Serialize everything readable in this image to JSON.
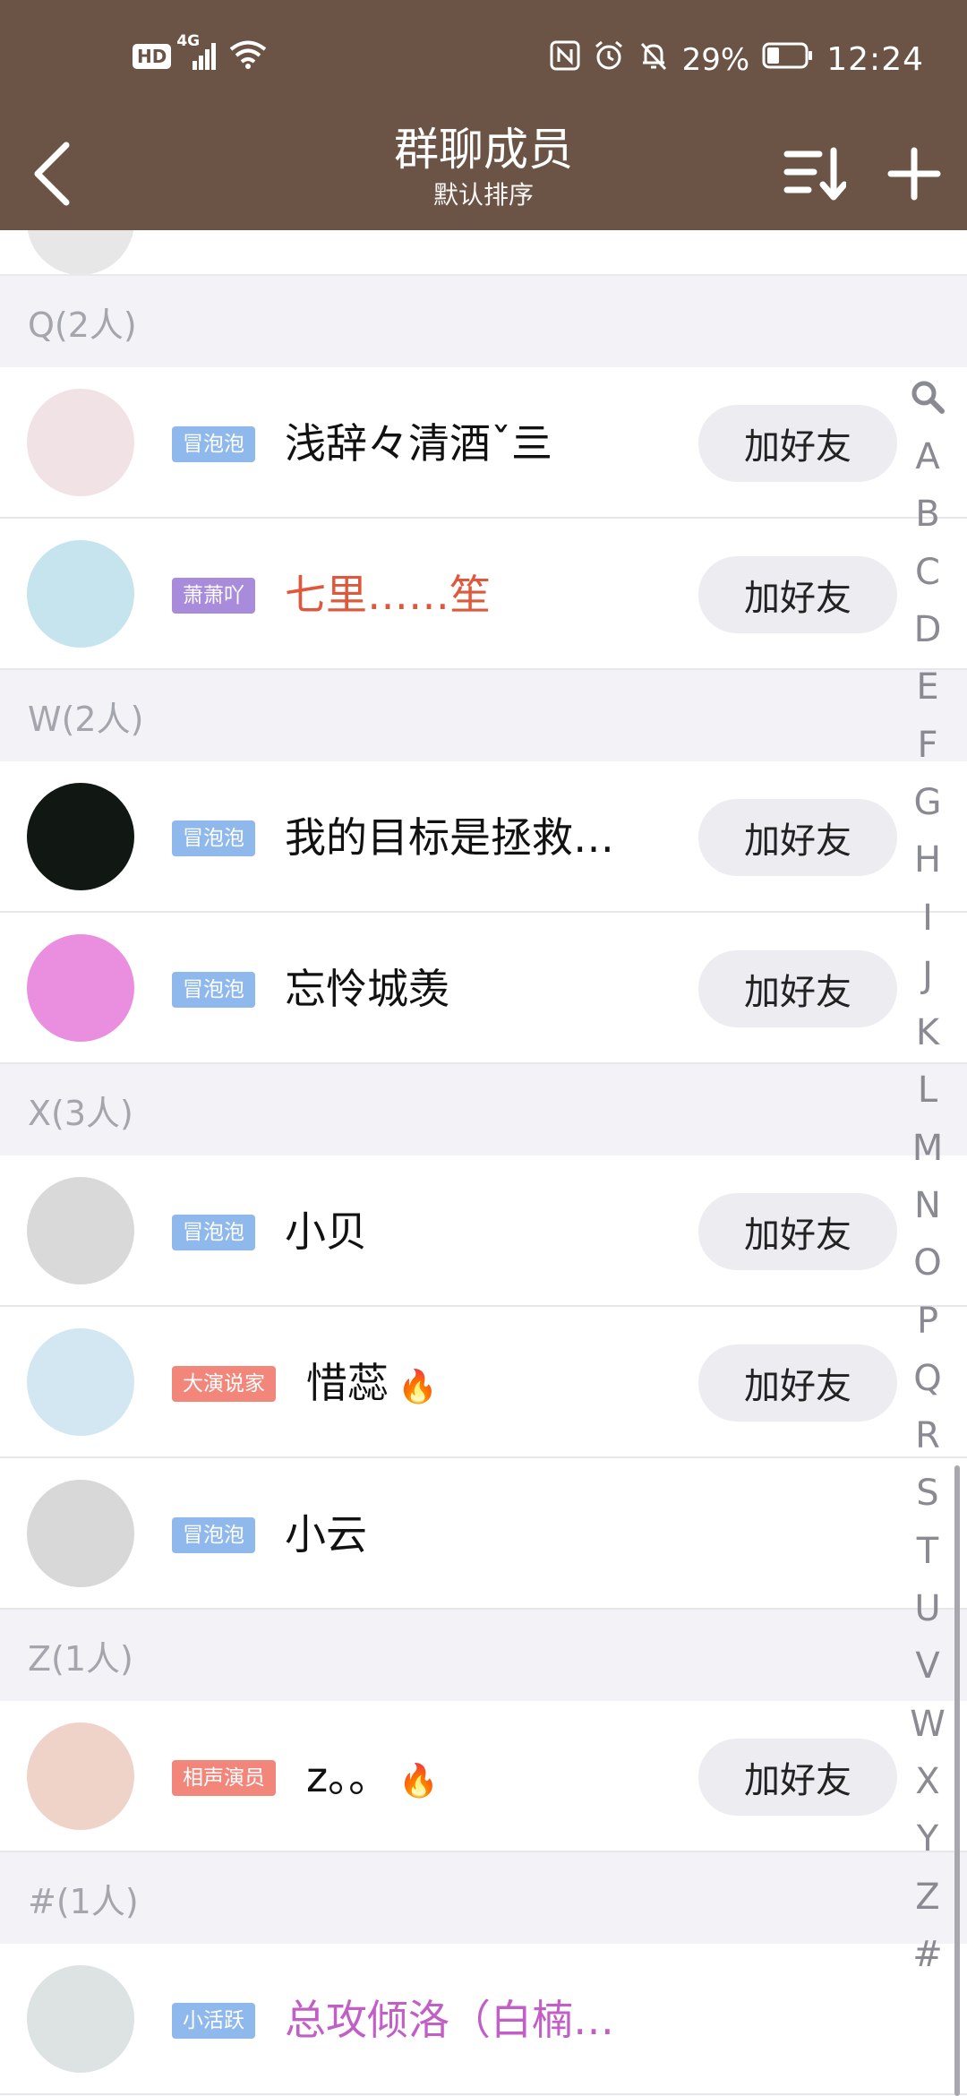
{
  "status_bar": {
    "hd": "HD",
    "signal": "4G",
    "battery_pct": "29%",
    "time": "12:24"
  },
  "header": {
    "title": "群聊成员",
    "subtitle": "默认排序",
    "icons": [
      "back-icon",
      "sort-icon",
      "add-icon"
    ]
  },
  "sections": [
    {
      "label": "Q(2人)",
      "members": [
        {
          "badge": "冒泡泡",
          "badge_color": "#8fb8ec",
          "name": "浅辞々清酒ˇ亖",
          "name_color": "#111111",
          "add": "加好友",
          "fire": "",
          "avatar_bg": "#f1e3e5"
        },
        {
          "badge": "萧萧吖",
          "badge_color": "#a98bdc",
          "name": "七里……笙",
          "name_color": "#e0583c",
          "add": "加好友",
          "fire": "",
          "avatar_bg": "#c5e4ee"
        }
      ]
    },
    {
      "label": "W(2人)",
      "members": [
        {
          "badge": "冒泡泡",
          "badge_color": "#8fb8ec",
          "name": "我的目标是拯救…",
          "name_color": "#111111",
          "add": "加好友",
          "fire": "",
          "avatar_bg": "#111814"
        },
        {
          "badge": "冒泡泡",
          "badge_color": "#8fb8ec",
          "name": "忘怜城羡",
          "name_color": "#111111",
          "add": "加好友",
          "fire": "",
          "avatar_bg": "#ea8ee0"
        }
      ]
    },
    {
      "label": "X(3人)",
      "members": [
        {
          "badge": "冒泡泡",
          "badge_color": "#8fb8ec",
          "name": "小贝",
          "name_color": "#111111",
          "add": "加好友",
          "fire": "",
          "avatar_bg": "#d9d9d9"
        },
        {
          "badge": "大演说家",
          "badge_color": "#f3867a",
          "name": "惜蕊",
          "name_color": "#111111",
          "add": "加好友",
          "fire": "🔥",
          "avatar_bg": "#d3e7f2"
        },
        {
          "badge": "冒泡泡",
          "badge_color": "#8fb8ec",
          "name": "小云",
          "name_color": "#111111",
          "add": "",
          "fire": "",
          "avatar_bg": "#d8d8d8"
        }
      ]
    },
    {
      "label": "Z(1人)",
      "members": [
        {
          "badge": "相声演员",
          "badge_color": "#f3867a",
          "name": "z。。",
          "name_color": "#111111",
          "add": "加好友",
          "fire": "🔥",
          "avatar_bg": "#efd3c8"
        }
      ]
    },
    {
      "label": "#(1人)",
      "members": [
        {
          "badge": "小活跃",
          "badge_color": "#8fb8ec",
          "name": "总攻倾洛（白楠…",
          "name_color": "#c15fc6",
          "add": "",
          "fire": "",
          "avatar_bg": "#dde2e3"
        }
      ]
    }
  ],
  "index_bar": [
    "A",
    "B",
    "C",
    "D",
    "E",
    "F",
    "G",
    "H",
    "I",
    "J",
    "K",
    "L",
    "M",
    "N",
    "O",
    "P",
    "Q",
    "R",
    "S",
    "T",
    "U",
    "V",
    "W",
    "X",
    "Y",
    "Z",
    "#"
  ]
}
